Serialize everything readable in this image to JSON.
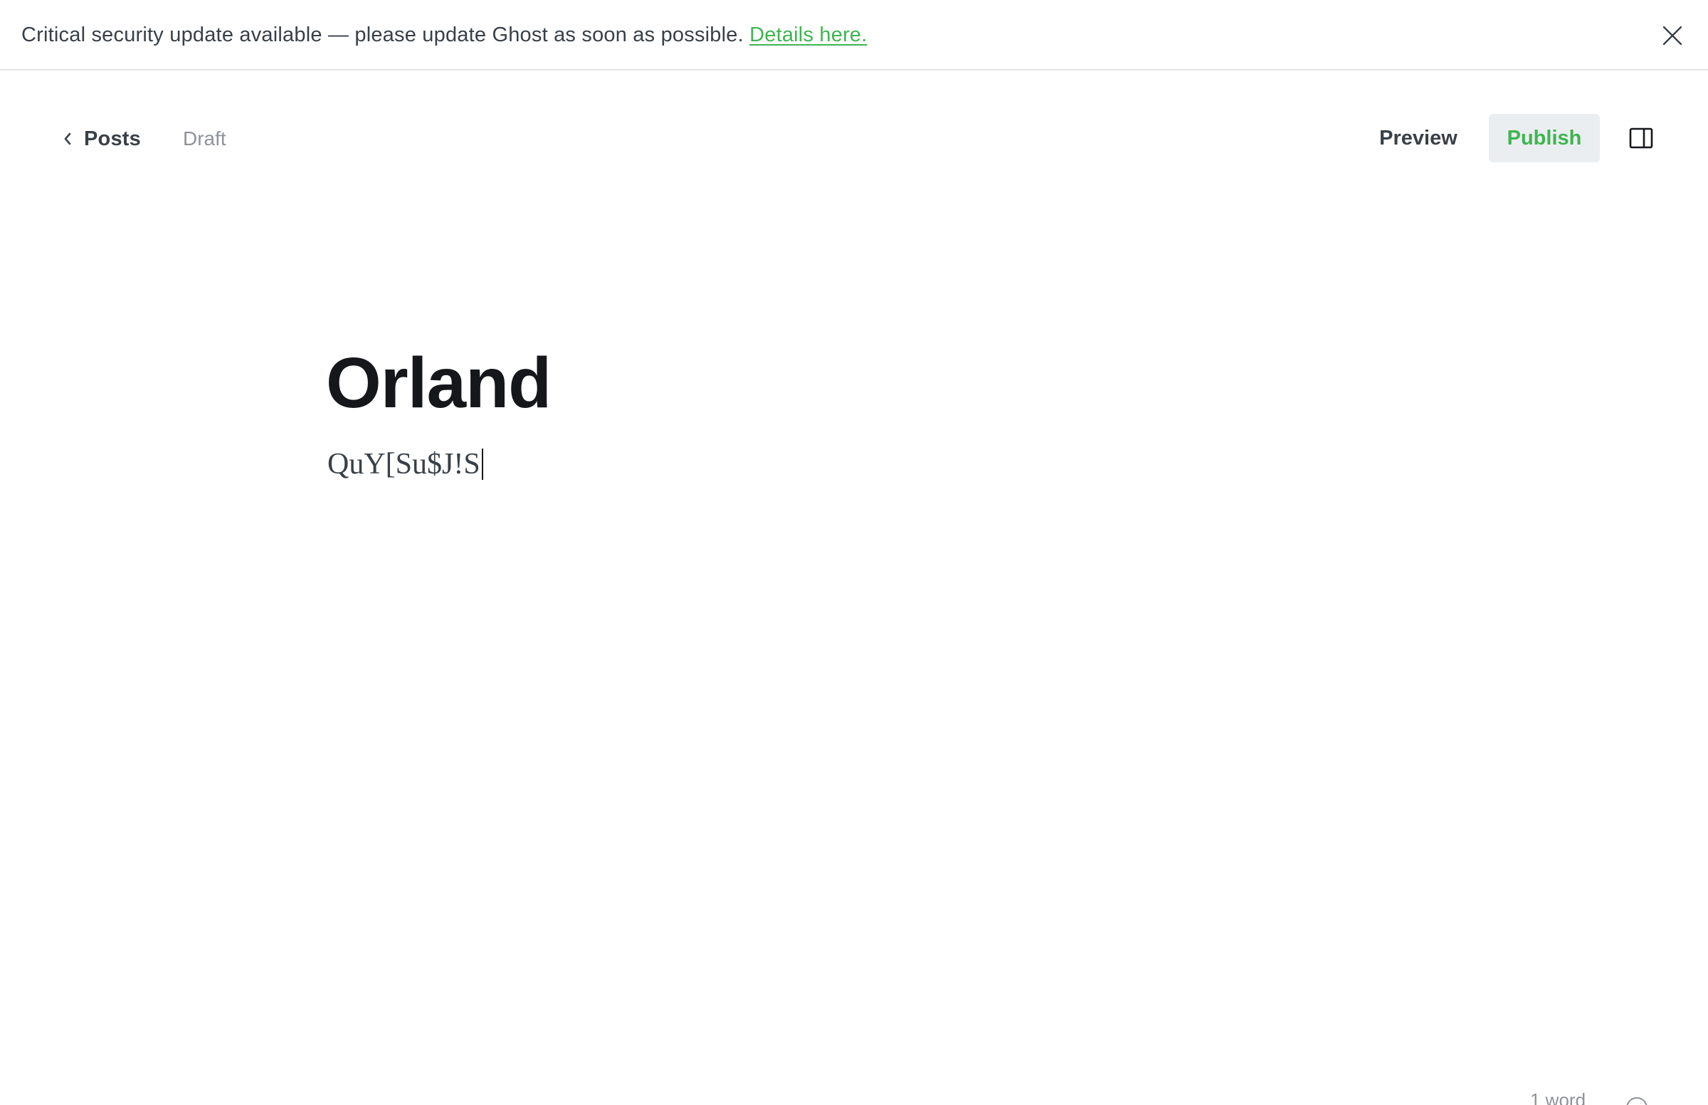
{
  "alert": {
    "message": "Critical security update available — please update Ghost as soon as possible. ",
    "link_label": "Details here.",
    "close_icon": "close-icon",
    "link_color": "#3eb550"
  },
  "header": {
    "back_label": "Posts",
    "back_icon": "chevron-left-icon",
    "status": "Draft",
    "preview_label": "Preview",
    "publish_label": "Publish",
    "sidebar_toggle_icon": "sidebar-panel-icon",
    "publish_color": "#3eb550",
    "publish_bg": "#ebeef0"
  },
  "editor": {
    "title": "Orland",
    "body": "QuY[Su$J!S"
  },
  "footer": {
    "word_count": "1 word",
    "help_icon": "help-circle-icon"
  }
}
